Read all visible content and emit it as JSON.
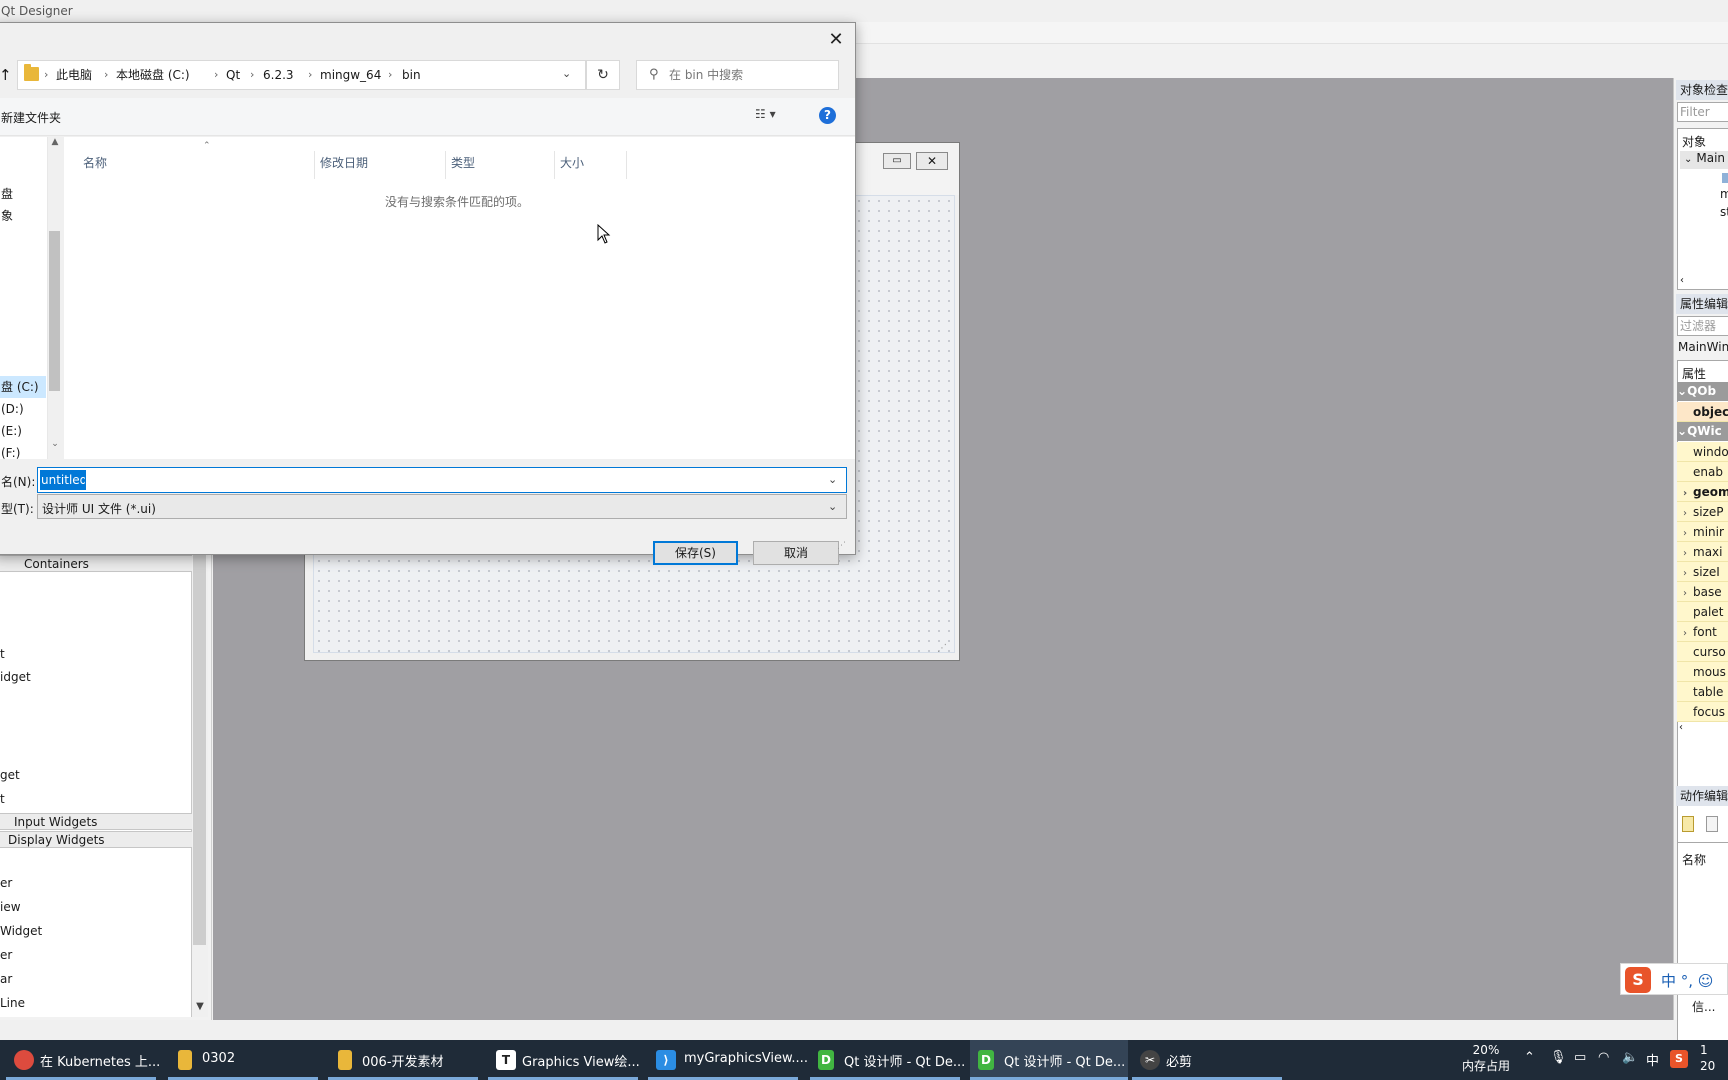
{
  "app": {
    "title": "Qt Designer",
    "widget_box": {
      "categories": [
        "Containers",
        "Input Widgets",
        "Display Widgets"
      ],
      "items_containers": [
        "t",
        "idget",
        "get",
        "t"
      ],
      "items_display": [
        "er",
        "iew",
        "Widget",
        "er",
        "ar",
        "Line"
      ]
    },
    "form": {
      "min_label": "▭",
      "close_label": "✕"
    },
    "right_dock": {
      "object_inspector_title": "对象检查",
      "filter_placeholder": "Filter",
      "object_header": "对象",
      "object_root": "Main",
      "object_children": [
        "m",
        "st"
      ],
      "property_editor_title": "属性编辑",
      "property_filter_placeholder": "过滤器",
      "property_object": "MainWin",
      "property_header": "属性",
      "groups": [
        "QOb",
        "QWic"
      ],
      "properties_qobject": [
        "objec"
      ],
      "properties_qwidget": [
        "windo",
        "enab",
        "geom",
        "sizeP",
        "minir",
        "maxi",
        "sizeI",
        "base",
        "palet",
        "font",
        "curso",
        "mous",
        "table",
        "focus"
      ],
      "action_editor_title": "动作编辑",
      "action_name_header": "名称",
      "signal_tab": "信..."
    },
    "ime": {
      "text": "中 °, ☺"
    }
  },
  "dialog": {
    "up_arrow": "↑",
    "breadcrumb": [
      "此电脑",
      "本地磁盘 (C:)",
      "Qt",
      "6.2.3",
      "mingw_64",
      "bin"
    ],
    "search_placeholder": "在 bin 中搜索",
    "new_folder": "新建文件夹",
    "nav_items": [
      "盘",
      "象",
      "盘 (C:)",
      " (D:)",
      " (E:)",
      " (F:)"
    ],
    "columns": [
      "名称",
      "修改日期",
      "类型",
      "大小"
    ],
    "empty_message": "没有与搜索条件匹配的项。",
    "filename_label": "名(N):",
    "filename_value": "untitled",
    "filetype_label": "型(T):",
    "filetype_value": "设计师 UI 文件 (*.ui)",
    "hide_folders": "‹",
    "save_label": "保存(S)",
    "cancel_label": "取消"
  },
  "taskbar": {
    "items": [
      {
        "label": "在 Kubernetes 上...",
        "icon": "chrome-icon",
        "color": "#dd4b3e"
      },
      {
        "label": "0302",
        "icon": "folder-icon",
        "color": "#e9b73a"
      },
      {
        "label": "006-开发素材",
        "icon": "folder-icon",
        "color": "#e9b73a"
      },
      {
        "label": "Graphics View绘...",
        "icon": "typora-icon",
        "color": "#ffffff"
      },
      {
        "label": "myGraphicsView....",
        "icon": "vscode-icon",
        "color": "#2b8de3"
      },
      {
        "label": "Qt 设计师 - Qt De...",
        "icon": "qt-designer-icon",
        "color": "#41b541"
      },
      {
        "label": "Qt 设计师 - Qt De...",
        "icon": "qt-designer-icon",
        "color": "#41b541"
      },
      {
        "label": "必剪",
        "icon": "bijian-icon",
        "color": "#444444"
      }
    ],
    "memory_percent": "20%",
    "memory_label": "内存占用",
    "ime_indicator": "中",
    "clock_time": "1",
    "clock_date": "20"
  }
}
